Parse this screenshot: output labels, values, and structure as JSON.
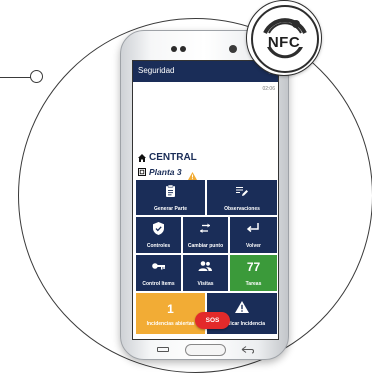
{
  "badge": {
    "label": "NFC",
    "icon": "nfc-icon"
  },
  "app": {
    "title": "Seguridad",
    "menu_glyph": "⋮",
    "clock": "02:06"
  },
  "location": {
    "site": "CENTRAL",
    "floor": "Planta 3",
    "icons": [
      "home-icon",
      "floor-plan-icon",
      "warning-icon"
    ]
  },
  "tiles": {
    "generar_parte": "Generar Parte",
    "observaciones": "Observaciones",
    "controles": "Controles",
    "cambiar_punto": "Cambiar punto",
    "volver": "Volver",
    "control_items": "Control Items",
    "visitas": "Visitas",
    "tareas_count": "77",
    "tareas": "Tareas",
    "incidencias_count": "1",
    "incidencias_abiertas": "Incidencias abiertas",
    "notificar_incidencia": "Notificar Incidencia"
  },
  "sos": "SOS",
  "colors": {
    "primary": "#1a2d58",
    "success": "#3b9a3a",
    "warning": "#f2ac35",
    "danger": "#e32a2a"
  }
}
